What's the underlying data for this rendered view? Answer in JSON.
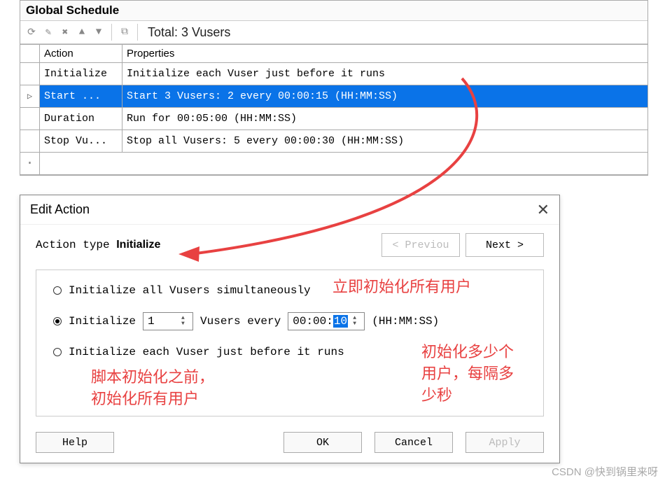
{
  "panel": {
    "title": "Global Schedule",
    "total": "Total: 3 Vusers"
  },
  "columns": {
    "action": "Action",
    "properties": "Properties"
  },
  "rows": [
    {
      "action": "Initialize",
      "props": "Initialize each Vuser just before it runs"
    },
    {
      "action": "Start  ...",
      "props": "Start 3 Vusers: 2 every 00:00:15 (HH:MM:SS)"
    },
    {
      "action": "Duration",
      "props": "Run for 00:05:00 (HH:MM:SS)"
    },
    {
      "action": "Stop Vu...",
      "props": "Stop all Vusers: 5 every 00:00:30 (HH:MM:SS)"
    }
  ],
  "dialog": {
    "title": "Edit Action",
    "action_type_label": "Action type",
    "action_type_value": "Initialize",
    "prev": "<  Previou",
    "next": "Next  >",
    "opt_all": "Initialize all Vusers simultaneously",
    "opt_interval_prefix": "Initialize",
    "opt_interval_count": "1",
    "opt_interval_mid": "Vusers every",
    "opt_interval_time_prefix": "00:00:",
    "opt_interval_time_sel": "10",
    "opt_interval_suffix": "(HH:MM:SS)",
    "opt_each": "Initialize each Vuser just before it runs",
    "help": "Help",
    "ok": "OK",
    "cancel": "Cancel",
    "apply": "Apply"
  },
  "annotations": {
    "a1": "立即初始化所有用户",
    "a2": "脚本初始化之前，\n初始化所有用户",
    "a3": "初始化多少个\n用户，每隔多\n少秒"
  },
  "watermark": "CSDN @快到锅里来呀"
}
